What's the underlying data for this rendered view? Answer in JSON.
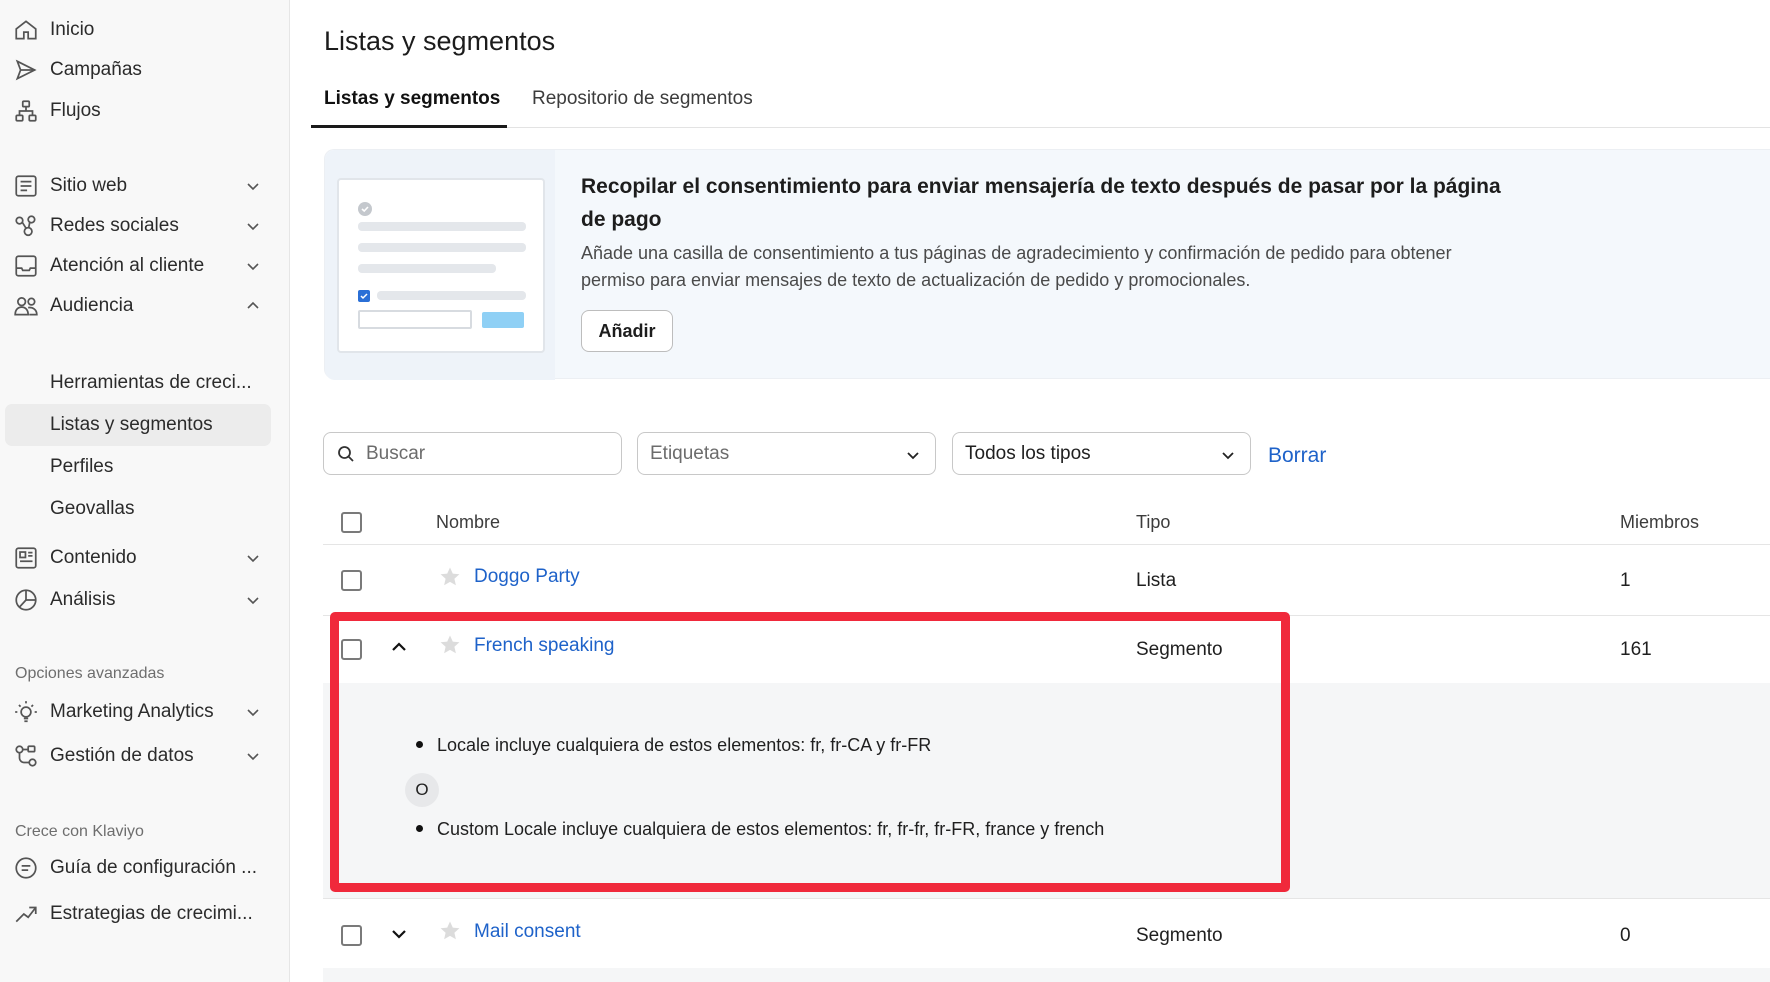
{
  "sidebar": {
    "top_items": [
      {
        "label": "Inicio",
        "icon": "home-icon"
      },
      {
        "label": "Campañas",
        "icon": "send-icon"
      },
      {
        "label": "Flujos",
        "icon": "flow-icon"
      }
    ],
    "items": [
      {
        "label": "Sitio web",
        "icon": "website-icon"
      },
      {
        "label": "Redes sociales",
        "icon": "social-icon"
      },
      {
        "label": "Atención al cliente",
        "icon": "inbox-icon"
      },
      {
        "label": "Audiencia",
        "icon": "audience-icon"
      },
      {
        "label": "Contenido",
        "icon": "content-icon"
      },
      {
        "label": "Análisis",
        "icon": "analytics-icon"
      }
    ],
    "audience_subitems": [
      "Herramientas de creci...",
      "Listas y segmentos",
      "Perfiles",
      "Geovallas"
    ],
    "advanced_title": "Opciones avanzadas",
    "advanced_items": [
      {
        "label": "Marketing Analytics",
        "icon": "bulb-icon"
      },
      {
        "label": "Gestión de datos",
        "icon": "data-icon"
      }
    ],
    "grow_title": "Crece con Klaviyo",
    "grow_items": [
      {
        "label": "Guía de configuración ...",
        "icon": "guide-icon"
      },
      {
        "label": "Estrategias de crecimi...",
        "icon": "trend-icon"
      }
    ]
  },
  "main": {
    "title": "Listas y segmentos",
    "tabs": [
      "Listas y segmentos",
      "Repositorio de segmentos"
    ],
    "banner": {
      "title": "Recopilar el consentimiento para enviar mensajería de texto después de pasar por la página de pago",
      "description": "Añade una casilla de consentimiento a tus páginas de agradecimiento y confirmación de pedido para obtener permiso para enviar mensajes de texto de actualización de pedido y promocionales.",
      "button": "Añadir"
    },
    "filters": {
      "search_placeholder": "Buscar",
      "tags_placeholder": "Etiquetas",
      "type_value": "Todos los tipos",
      "clear": "Borrar"
    },
    "table": {
      "headers": [
        "Nombre",
        "Tipo",
        "Miembros"
      ],
      "rows": [
        {
          "name": "Doggo Party",
          "type": "Lista",
          "members": "1"
        },
        {
          "name": "French speaking",
          "type": "Segmento",
          "members": "161"
        },
        {
          "name": "Mail consent",
          "type": "Segmento",
          "members": "0"
        }
      ],
      "detail": {
        "conditions": [
          "Locale incluye cualquiera de estos elementos: fr, fr-CA y fr-FR",
          "Custom Locale incluye cualquiera de estos elementos: fr, fr-fr, fr-FR, france y french"
        ],
        "operator": "O"
      }
    }
  },
  "colors": {
    "link": "#1e62c9",
    "highlight": "#f0293b"
  }
}
